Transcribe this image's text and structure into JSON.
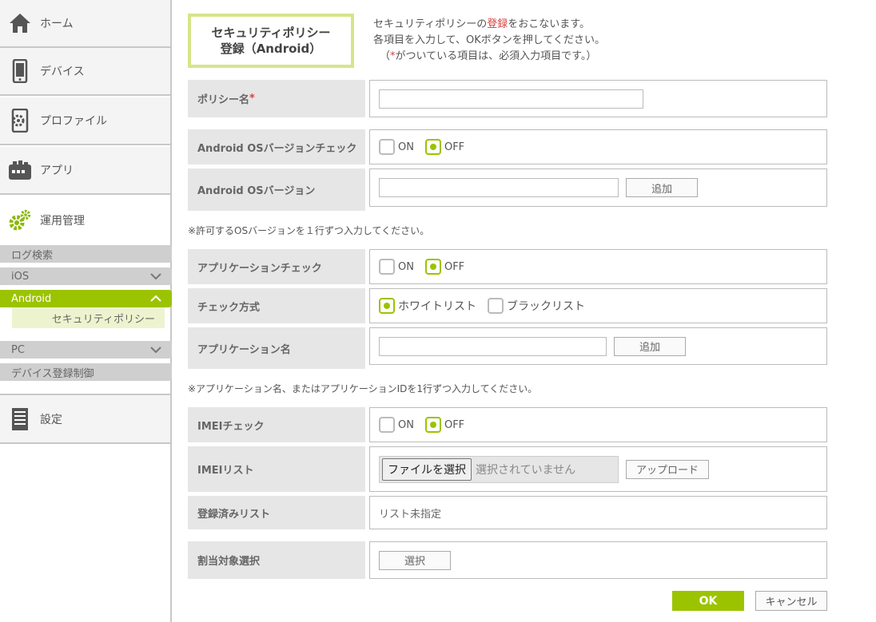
{
  "sidebar": {
    "items": [
      {
        "label": "ホーム",
        "icon": "home-icon"
      },
      {
        "label": "デバイス",
        "icon": "smartphone-icon"
      },
      {
        "label": "プロファイル",
        "icon": "profile-gear-icon"
      },
      {
        "label": "アプリ",
        "icon": "app-icon"
      },
      {
        "label": "運用管理",
        "icon": "gears-icon"
      },
      {
        "label": "設定",
        "icon": "document-icon"
      }
    ],
    "sub_items": {
      "log_search": "ログ検索",
      "ios": "iOS",
      "android": "Android",
      "security_policy": "セキュリティポリシー",
      "pc": "PC",
      "device_registration": "デバイス登録制御"
    }
  },
  "header": {
    "title_line1": "セキュリティポリシー",
    "title_line2": "登録（Android）",
    "intro_line1_pre": "セキュリティポリシーの",
    "intro_line1_red": "登録",
    "intro_line1_post": "をおこないます。",
    "intro_line2": "各項目を入力して、OKボタンを押してください。",
    "intro_line3_pre": "（",
    "intro_line3_red": "*",
    "intro_line3_post": "がついている項目は、必須入力項目です。）"
  },
  "form": {
    "policy_name": {
      "label": "ポリシー名",
      "required_mark": "*",
      "value": ""
    },
    "os_version_check": {
      "label": "Android OSバージョンチェック",
      "on": "ON",
      "off": "OFF",
      "selected": "OFF"
    },
    "os_version": {
      "label": "Android OSバージョン",
      "value": "",
      "add": "追加"
    },
    "os_note": "※許可するOSバージョンを１行ずつ入力してください。",
    "app_check": {
      "label": "アプリケーションチェック",
      "on": "ON",
      "off": "OFF",
      "selected": "OFF"
    },
    "check_method": {
      "label": "チェック方式",
      "whitelist": "ホワイトリスト",
      "blacklist": "ブラックリスト",
      "selected": "ホワイトリスト"
    },
    "app_name": {
      "label": "アプリケーション名",
      "value": "",
      "add": "追加"
    },
    "app_note": "※アプリケーション名、またはアプリケーションIDを1行ずつ入力してください。",
    "imei_check": {
      "label": "IMEIチェック",
      "on": "ON",
      "off": "OFF",
      "selected": "OFF"
    },
    "imei_list": {
      "label": "IMEIリスト",
      "choose_file": "ファイルを選択",
      "no_file": "選択されていません",
      "upload": "アップロード"
    },
    "registered_list": {
      "label": "登録済みリスト",
      "value": "リスト未指定"
    },
    "assign_target": {
      "label": "割当対象選択",
      "select": "選択"
    }
  },
  "actions": {
    "ok": "OK",
    "cancel": "キャンセル"
  },
  "colors": {
    "accent": "#9cc300",
    "required": "#d84040",
    "title_border": "#d6e58a"
  }
}
